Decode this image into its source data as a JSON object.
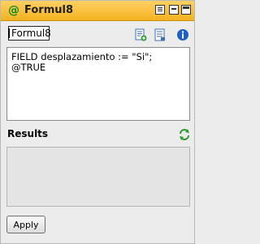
{
  "window": {
    "title": "Formul8",
    "title_icon": "at-sign",
    "controls": [
      "doc-icon",
      "minimize-icon",
      "maximize-icon"
    ]
  },
  "form": {
    "name_value": "Formul8"
  },
  "toolbar_icons": [
    "new-formula-icon",
    "edit-formula-icon",
    "info-icon"
  ],
  "editor": {
    "text": "FIELD desplazamiento := \"Si\";\n@TRUE"
  },
  "results": {
    "label": "Results",
    "refresh_icon": "refresh-icon"
  },
  "actions": {
    "apply_label": "Apply"
  },
  "colors": {
    "title_bar": "#f3b320",
    "title_icon": "#0b8d1f",
    "info_icon": "#1f5fbf"
  }
}
